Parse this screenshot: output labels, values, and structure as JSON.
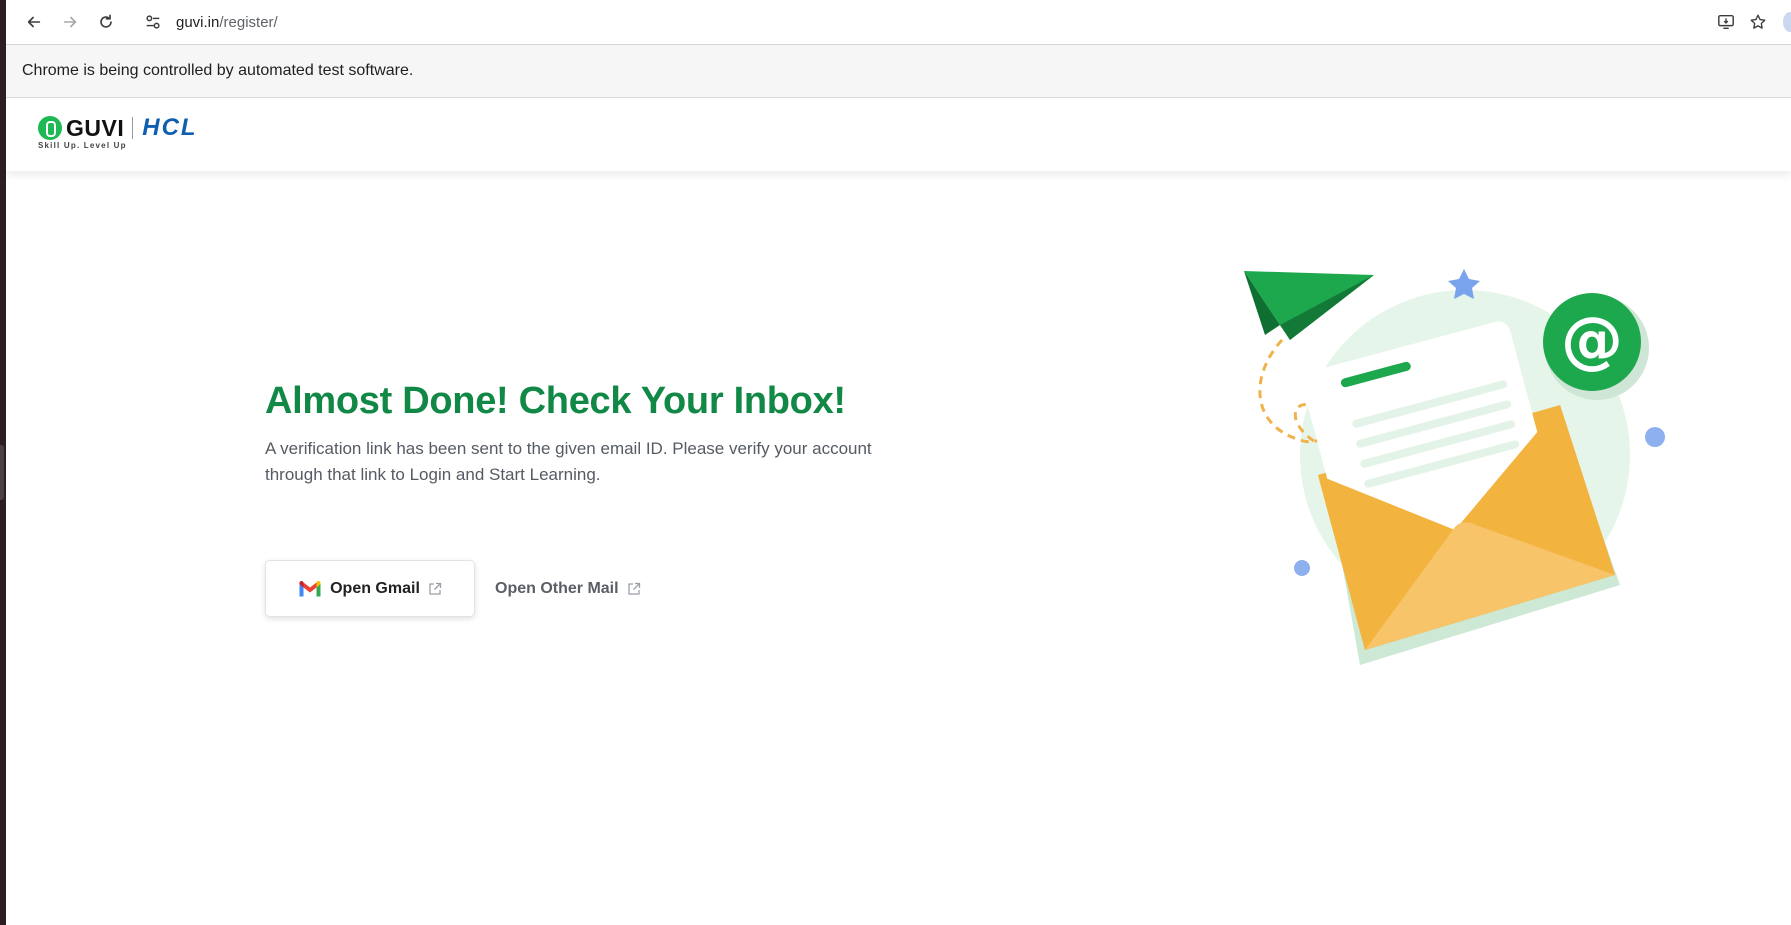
{
  "browser": {
    "url_host": "guvi.in",
    "url_path": "/register/",
    "infobar_text": "Chrome is being controlled by automated test software."
  },
  "header": {
    "logo_guvi": "GUVI",
    "logo_hcl": "HCL",
    "logo_tagline": "Skill Up. Level Up"
  },
  "main": {
    "headline": "Almost Done! Check Your Inbox!",
    "subtext": "A verification link has been sent to the given email ID. Please verify your account through that link to Login and Start Learning.",
    "gmail_button_label": "Open Gmail",
    "other_mail_button_label": "Open Other Mail"
  },
  "colors": {
    "brand_green": "#118845",
    "logo_green": "#1db954",
    "hcl_blue": "#0f5fb0",
    "envelope_orange": "#f2b441"
  },
  "icons": [
    "back-arrow-icon",
    "forward-arrow-icon",
    "reload-icon",
    "site-settings-icon",
    "install-app-icon",
    "bookmark-star-icon",
    "gmail-icon",
    "external-link-icon"
  ]
}
